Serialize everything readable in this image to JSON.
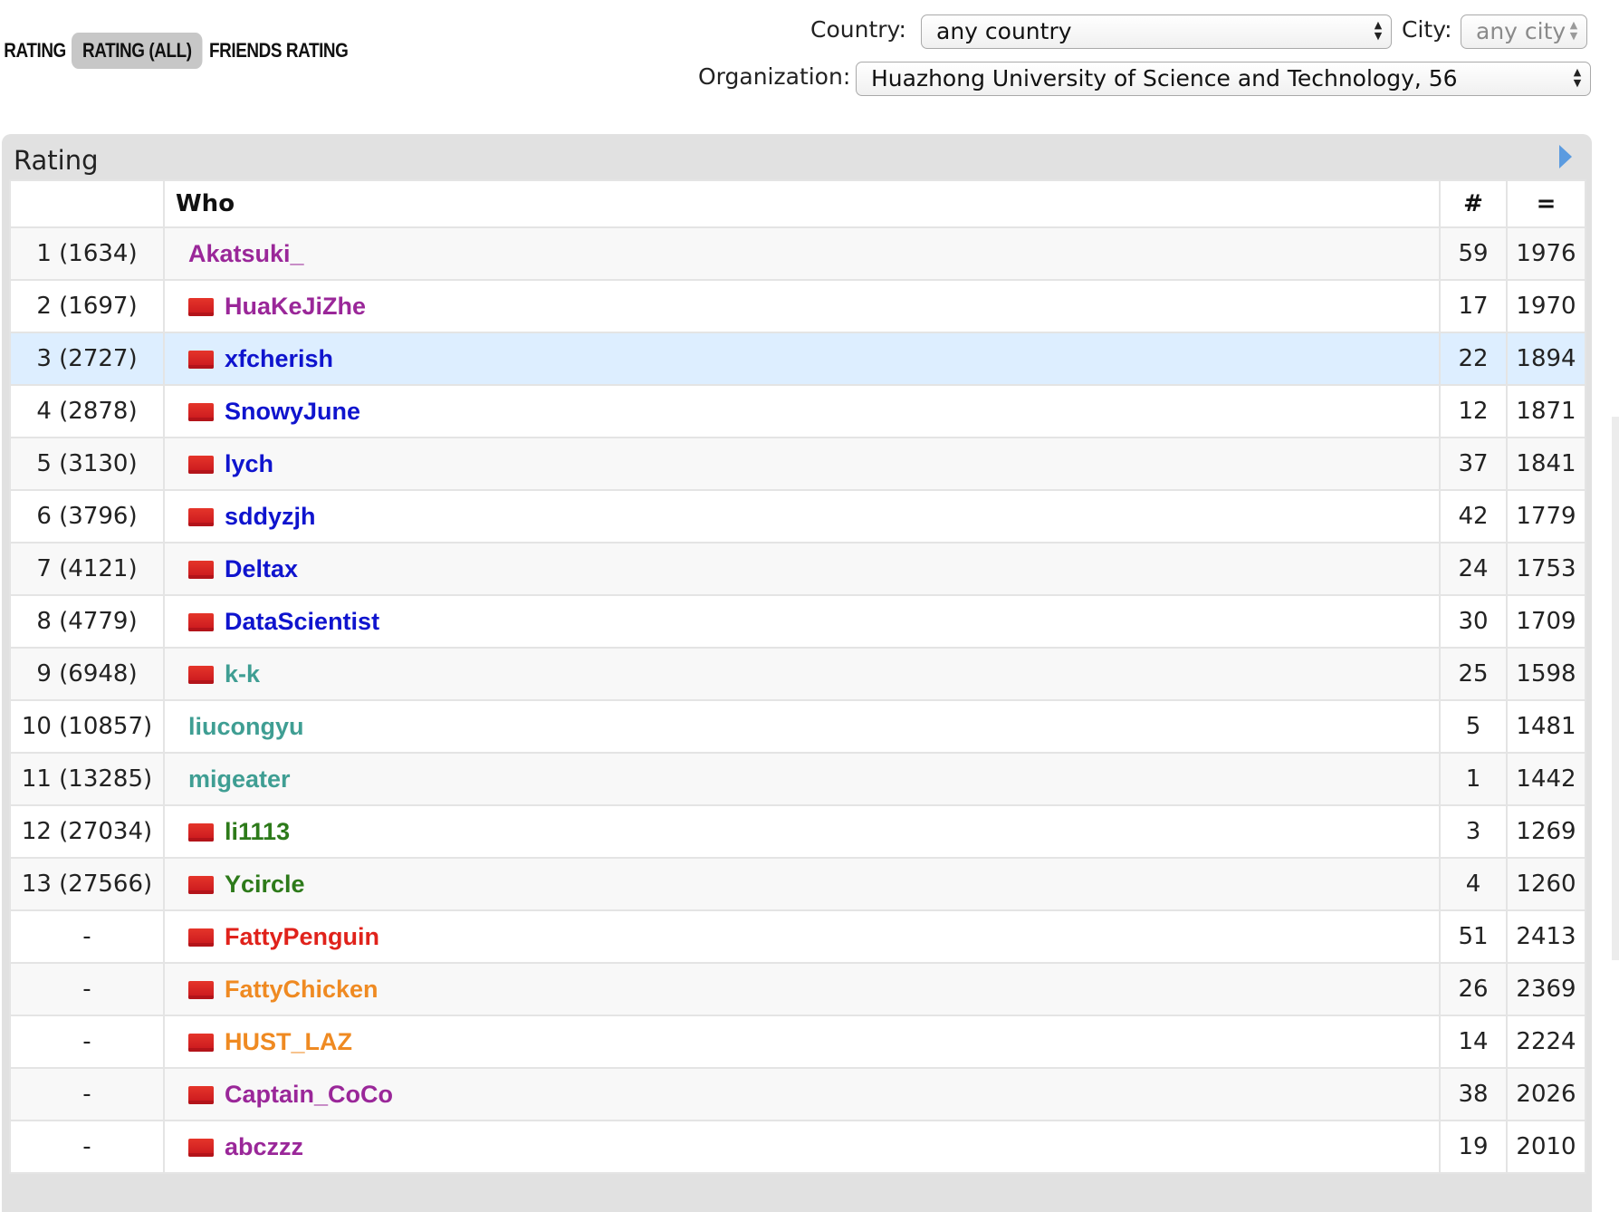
{
  "tabs": [
    {
      "label": "RATING"
    },
    {
      "label": "RATING (ALL)"
    },
    {
      "label": "FRIENDS RATING"
    }
  ],
  "filters": {
    "country_label": "Country:",
    "country_value": "any country",
    "city_label": "City:",
    "city_value": "any city",
    "organization_label": "Organization:",
    "organization_value": "Huazhong University of Science and Technology, 56"
  },
  "panel": {
    "title": "Rating",
    "columns": {
      "rank": "",
      "who": "Who",
      "count": "#",
      "rating": "="
    }
  },
  "colors": {
    "purple": "#9a2799",
    "blue": "#0f14ce",
    "cyan": "#3f9e93",
    "green": "#2d7a1a",
    "red": "#e0221b",
    "orange": "#ef8a22",
    "highlight_row": "#ddeeff"
  },
  "rows": [
    {
      "rank": "1 (1634)",
      "flag": false,
      "name": "Akatsuki_",
      "color": "#9a2799",
      "count": "59",
      "rating": "1976"
    },
    {
      "rank": "2 (1697)",
      "flag": true,
      "name": "HuaKeJiZhe",
      "color": "#9a2799",
      "count": "17",
      "rating": "1970"
    },
    {
      "rank": "3 (2727)",
      "flag": true,
      "name": "xfcherish",
      "color": "#0f14ce",
      "count": "22",
      "rating": "1894",
      "highlight": true
    },
    {
      "rank": "4 (2878)",
      "flag": true,
      "name": "SnowyJune",
      "color": "#0f14ce",
      "count": "12",
      "rating": "1871"
    },
    {
      "rank": "5 (3130)",
      "flag": true,
      "name": "lych",
      "color": "#0f14ce",
      "count": "37",
      "rating": "1841"
    },
    {
      "rank": "6 (3796)",
      "flag": true,
      "name": "sddyzjh",
      "color": "#0f14ce",
      "count": "42",
      "rating": "1779"
    },
    {
      "rank": "7 (4121)",
      "flag": true,
      "name": "Deltax",
      "color": "#0f14ce",
      "count": "24",
      "rating": "1753"
    },
    {
      "rank": "8 (4779)",
      "flag": true,
      "name": "DataScientist",
      "color": "#0f14ce",
      "count": "30",
      "rating": "1709"
    },
    {
      "rank": "9 (6948)",
      "flag": true,
      "name": "k-k",
      "color": "#3f9e93",
      "count": "25",
      "rating": "1598"
    },
    {
      "rank": "10 (10857)",
      "flag": false,
      "name": "liucongyu",
      "color": "#3f9e93",
      "count": "5",
      "rating": "1481"
    },
    {
      "rank": "11 (13285)",
      "flag": false,
      "name": "migeater",
      "color": "#3f9e93",
      "count": "1",
      "rating": "1442"
    },
    {
      "rank": "12 (27034)",
      "flag": true,
      "name": "li1113",
      "color": "#2d7a1a",
      "count": "3",
      "rating": "1269"
    },
    {
      "rank": "13 (27566)",
      "flag": true,
      "name": "Ycircle",
      "color": "#2d7a1a",
      "count": "4",
      "rating": "1260"
    },
    {
      "rank": "-",
      "flag": true,
      "name": "FattyPenguin",
      "color": "#e0221b",
      "count": "51",
      "rating": "2413"
    },
    {
      "rank": "-",
      "flag": true,
      "name": "FattyChicken",
      "color": "#ef8a22",
      "count": "26",
      "rating": "2369"
    },
    {
      "rank": "-",
      "flag": true,
      "name": "HUST_LAZ",
      "color": "#ef8a22",
      "count": "14",
      "rating": "2224"
    },
    {
      "rank": "-",
      "flag": true,
      "name": "Captain_CoCo",
      "color": "#9a2799",
      "count": "38",
      "rating": "2026"
    },
    {
      "rank": "-",
      "flag": true,
      "name": "abczzz",
      "color": "#9a2799",
      "count": "19",
      "rating": "2010"
    }
  ]
}
